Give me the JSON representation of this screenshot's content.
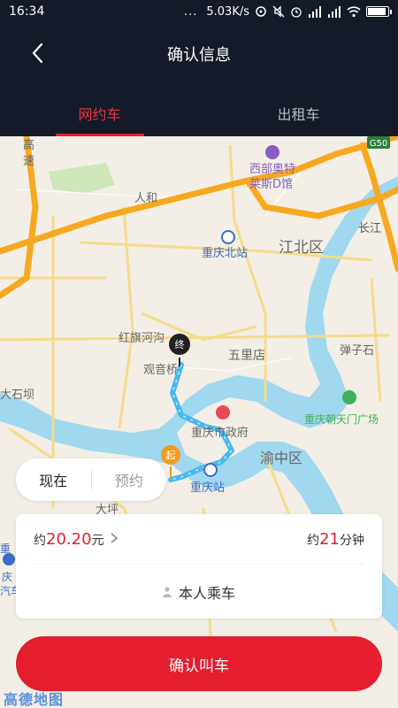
{
  "status_bar": {
    "time": "16:34",
    "dots": "...",
    "speed": "5.03K/s"
  },
  "header": {
    "title": "确认信息",
    "tabs": [
      {
        "label": "网约车",
        "active": true
      },
      {
        "label": "出租车",
        "active": false
      }
    ]
  },
  "map": {
    "labels": {
      "g50": "G50",
      "gao": "高",
      "su": "速",
      "west_outlet": "西部奥特",
      "lai_d": "莱斯D馆",
      "renhe": "人和",
      "jiangbei": "江北区",
      "changjiang": "长江",
      "chongqing_north": "重庆北站",
      "hongqihe": "红旗河沟",
      "guanyinqiao": "观音桥",
      "wulidian": "五里店",
      "danzishi": "弹子石",
      "dashiba": "大石坝",
      "chaotianmen": "重庆朝天门广场",
      "city_gov": "重庆市政府",
      "yuzhong": "渝中区",
      "chongqing_station": "重庆站",
      "daping": "大坪",
      "qing": "庆",
      "qiche": "汽车",
      "zhong": "重"
    },
    "markers": {
      "end": "终",
      "start": "起"
    }
  },
  "time_selector": {
    "now": "现在",
    "reserve": "预约"
  },
  "estimate": {
    "price_prefix": "约",
    "price_value": "20.20",
    "price_unit": "元",
    "eta_prefix": "约",
    "eta_value": "21",
    "eta_unit": "分钟",
    "passenger": "本人乘车"
  },
  "confirm_button": "确认叫车",
  "brand": "高德地图",
  "colors": {
    "header_bg": "#141a27",
    "accent": "#e41e2e",
    "route": "#46b9f0",
    "river": "#9fd8ef",
    "expressway": "#f6a920",
    "road": "#f6db8a"
  }
}
